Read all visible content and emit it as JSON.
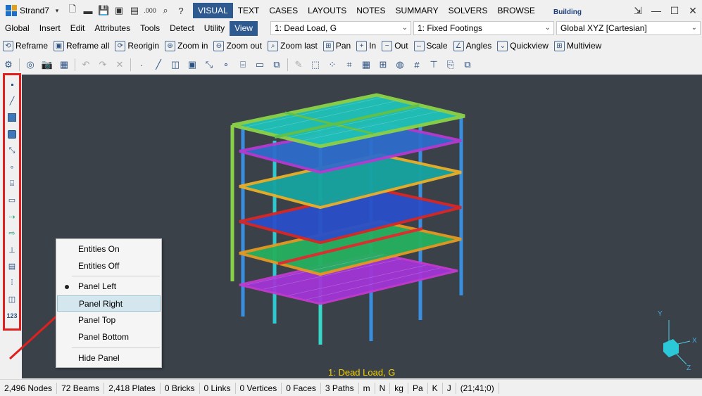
{
  "app": {
    "name": "Strand7",
    "badge": "Building"
  },
  "mode_tabs": [
    "VISUAL",
    "TEXT",
    "CASES",
    "LAYOUTS",
    "NOTES",
    "SUMMARY",
    "SOLVERS",
    "BROWSE"
  ],
  "active_mode_tab": "VISUAL",
  "menu": [
    "Global",
    "Insert",
    "Edit",
    "Attributes",
    "Tools",
    "Detect",
    "Utility",
    "View"
  ],
  "active_menu": "View",
  "combos": {
    "load_case": "1: Dead Load, G",
    "freedom_case": "1: Fixed Footings",
    "coord_system": "Global XYZ [Cartesian]"
  },
  "view_toolbar": [
    {
      "label": "Reframe",
      "icon": "reframe-icon"
    },
    {
      "label": "Reframe all",
      "icon": "reframe-all-icon"
    },
    {
      "label": "Reorigin",
      "icon": "reorigin-icon"
    },
    {
      "label": "Zoom in",
      "icon": "zoom-in-icon"
    },
    {
      "label": "Zoom out",
      "icon": "zoom-out-icon"
    },
    {
      "label": "Zoom last",
      "icon": "zoom-last-icon"
    },
    {
      "label": "Pan",
      "icon": "pan-icon"
    },
    {
      "label": "In",
      "icon": "in-icon"
    },
    {
      "label": "Out",
      "icon": "out-icon"
    },
    {
      "label": "Scale",
      "icon": "scale-icon"
    },
    {
      "label": "Angles",
      "icon": "angles-icon"
    },
    {
      "label": "Quickview",
      "icon": "quickview-icon"
    },
    {
      "label": "Multiview",
      "icon": "multiview-icon"
    }
  ],
  "context_menu": {
    "items": [
      "Entities On",
      "Entities Off",
      "Panel Left",
      "Panel Right",
      "Panel Top",
      "Panel Bottom",
      "Hide Panel"
    ],
    "checked": "Panel Left",
    "hovered": "Panel Right"
  },
  "viewport": {
    "case_label": "1: Dead Load, G",
    "axes": {
      "x": "X",
      "y": "Y",
      "z": "Z"
    }
  },
  "left_panel_badge": "123",
  "status": [
    "2,496 Nodes",
    "72 Beams",
    "2,418 Plates",
    "0 Bricks",
    "0 Links",
    "0 Vertices",
    "0 Faces",
    "3 Paths",
    "m",
    "N",
    "kg",
    "Pa",
    "K",
    "J",
    "(21;41;0)"
  ],
  "colors": {
    "accent": "#2f5a8f",
    "highlight_border": "#e0201e",
    "viewport_bg": "#3b4149",
    "case_label": "#f6d200"
  }
}
